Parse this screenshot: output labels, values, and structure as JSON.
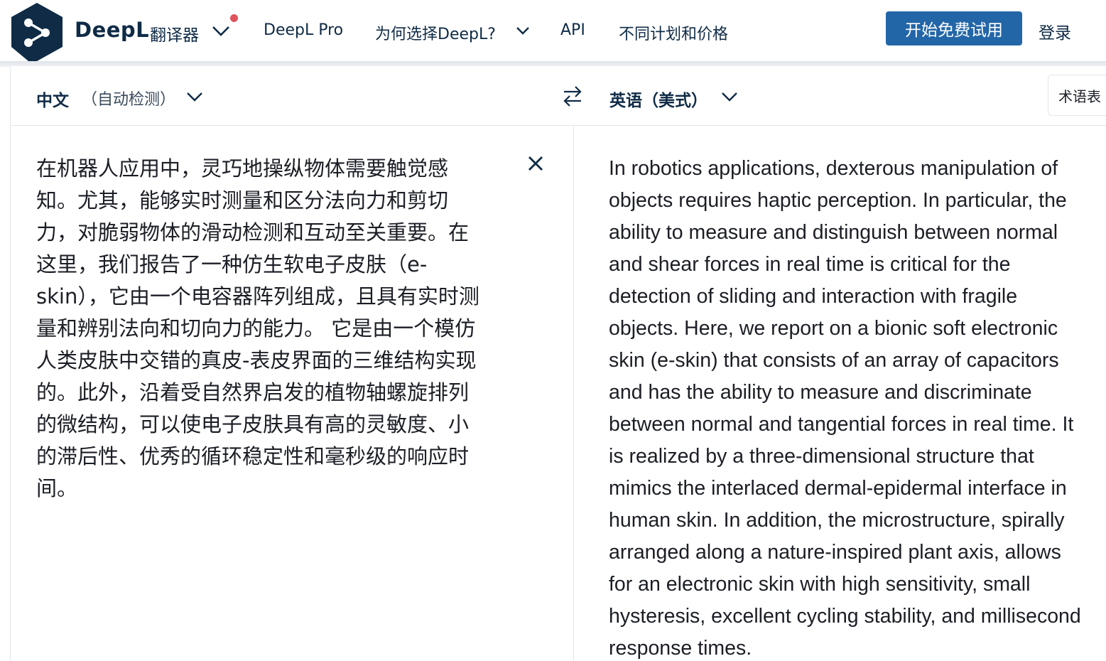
{
  "header": {
    "brand_name": "DeepL",
    "brand_sub": "翻译器",
    "nav": {
      "pro": "DeepL Pro",
      "why": "为何选择DeepL?",
      "api": "API",
      "pricing": "不同计划和价格"
    },
    "cta_label": "开始免费试用",
    "login_label": "登录",
    "notification_color": "#e0535c",
    "brand_color": "#0f2b46",
    "cta_color": "#2366a8"
  },
  "translator": {
    "source_lang": "中文",
    "source_detect": "（自动检测）",
    "target_lang": "英语（美式）",
    "glossary_label": "术语表",
    "source_lines": [
      "在机器人应用中，灵巧地操纵物体需要触觉感",
      "知。尤其，能够实时测量和区分法向力和剪切",
      "力，对脆弱物体的滑动检测和互动至关重要。在",
      "这里，我们报告了一种仿生软电子皮肤（e-",
      "skin），它由一个电容器阵列组成，且具有实时测",
      "量和辨别法向和切向力的能力。 它是由一个模仿",
      "人类皮肤中交错的真皮-表皮界面的三维结构实现",
      "的。此外，沿着受自然界启发的植物轴螺旋排列",
      "的微结构，可以使电子皮肤具有高的灵敏度、小",
      "的滞后性、优秀的循环稳定性和毫秒级的响应时",
      "间。"
    ],
    "target_lines": [
      "In robotics applications, dexterous manipulation of",
      "objects requires haptic perception. In particular, the",
      "ability to measure and distinguish between normal",
      "and shear forces in real time is critical for the",
      "detection of sliding and interaction with fragile",
      "objects. Here, we report on a bionic soft electronic",
      "skin (e-skin) that consists of an array of capacitors",
      "and has the ability to measure and discriminate",
      "between normal and tangential forces in real time. It",
      "is realized by a three-dimensional structure that",
      "mimics the interlaced dermal-epidermal interface in",
      "human skin. In addition, the microstructure, spirally",
      "arranged along a nature-inspired plant axis, allows",
      "for an electronic skin with high sensitivity, small",
      "hysteresis, excellent cycling stability, and millisecond",
      "response times."
    ]
  }
}
